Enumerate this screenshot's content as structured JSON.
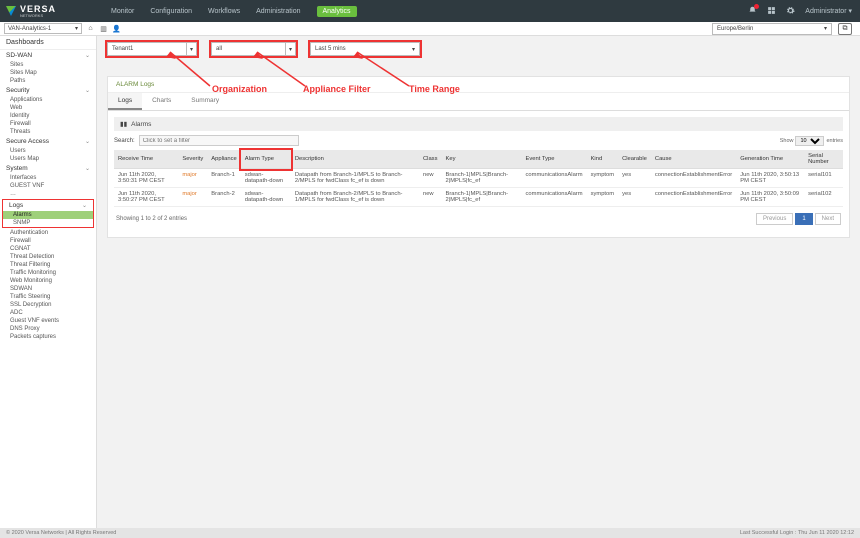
{
  "brand": {
    "name": "VERSA",
    "sub": "NETWORKS"
  },
  "topnav": {
    "items": [
      "Monitor",
      "Configuration",
      "Workflows",
      "Administration",
      "Analytics"
    ],
    "active": 4
  },
  "header": {
    "user": "Administrator",
    "tenant": "VAN-Analytics-1",
    "timezone": "Europe/Berlin"
  },
  "sidebar": {
    "title": "Dashboards",
    "groups": [
      {
        "label": "SD-WAN",
        "items": [
          "Sites",
          "Sites Map",
          "Paths"
        ]
      },
      {
        "label": "Security",
        "items": [
          "Applications",
          "Web",
          "Identity",
          "Firewall",
          "Threats"
        ]
      },
      {
        "label": "Secure Access",
        "items": [
          "Users",
          "Users Map"
        ]
      },
      {
        "label": "System",
        "items": [
          "Interfaces",
          "GUEST VNF",
          "…"
        ]
      }
    ],
    "logsLabel": "Logs",
    "logs": [
      "Alarms",
      "SNMP",
      "Authentication",
      "Firewall",
      "CGNAT",
      "Threat Detection",
      "Threat Filtering",
      "Traffic Monitoring",
      "Web Monitoring",
      "SDWAN",
      "Traffic Steering",
      "SSL Decryption",
      "ADC",
      "Guest VNF events",
      "DNS Proxy",
      "Packets captures"
    ],
    "logsSelected": 0
  },
  "filters": {
    "org": "Tenant1",
    "orgAnno": "Organization",
    "appliance": "all",
    "appAnno": "Appliance Filter",
    "time": "Last 5 mins",
    "timeAnno": "Time Range"
  },
  "panel": {
    "title": "ALARM Logs",
    "tabs": [
      "Logs",
      "Charts",
      "Summary"
    ],
    "activeTab": 0,
    "heading": "Alarms",
    "searchLabel": "Search:",
    "searchPlaceholder": "Click to set a filter",
    "showLabelA": "Show",
    "showLabelB": "entries",
    "showVal": "10",
    "columns": [
      "Receive Time",
      "Severity",
      "Appliance",
      "Alarm Type",
      "Description",
      "Class",
      "Key",
      "Event Type",
      "Kind",
      "Clearable",
      "Cause",
      "Generation Time",
      "Serial Number"
    ],
    "rows": [
      {
        "c": [
          "Jun 11th 2020, 3:50:31 PM CEST",
          "major",
          "Branch-1",
          "sdwan-datapath-down",
          "Datapath from Branch-1/MPLS to Branch-2/MPLS for fwdClass fc_ef is down",
          "new",
          "Branch-1|MPLS|Branch-2|MPLS|fc_ef",
          "communicationsAlarm",
          "symptom",
          "yes",
          "connectionEstablishmentError",
          "Jun 11th 2020, 3:50:13 PM CEST",
          "serial101"
        ]
      },
      {
        "c": [
          "Jun 11th 2020, 3:50:27 PM CEST",
          "major",
          "Branch-2",
          "sdwan-datapath-down",
          "Datapath from Branch-2/MPLS to Branch-1/MPLS for fwdClass fc_ef is down",
          "new",
          "Branch-1|MPLS|Branch-2|MPLS|fc_ef",
          "communicationsAlarm",
          "symptom",
          "yes",
          "connectionEstablishmentError",
          "Jun 11th 2020, 3:50:09 PM CEST",
          "serial102"
        ]
      }
    ],
    "countText": "Showing 1 to 2 of 2 entries",
    "prev": "Previous",
    "next": "Next",
    "page": "1"
  },
  "footer": {
    "copy": "© 2020 Versa Networks | All Rights Reserved",
    "login": "Last Successful Login : Thu Jun 11 2020 12:12"
  }
}
